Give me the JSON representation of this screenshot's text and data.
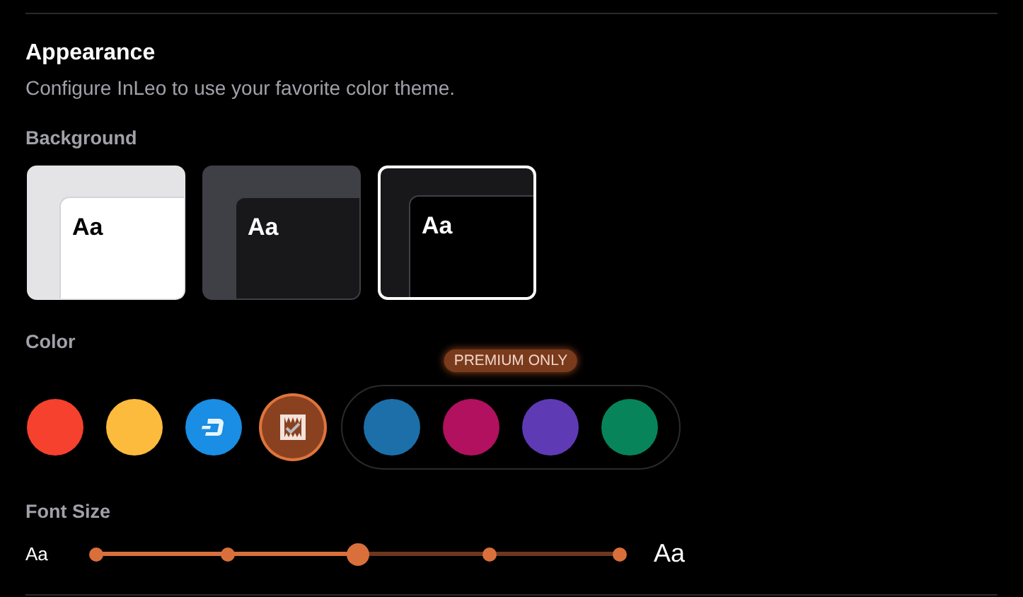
{
  "section": {
    "title": "Appearance",
    "description": "Configure InLeo to use your favorite color theme."
  },
  "background": {
    "label": "Background",
    "options": [
      {
        "kind": "light",
        "sample": "Aa",
        "selected": false
      },
      {
        "kind": "dim",
        "sample": "Aa",
        "selected": false
      },
      {
        "kind": "dark",
        "sample": "Aa",
        "selected": true
      }
    ]
  },
  "color": {
    "label": "Color",
    "swatches": [
      {
        "kind": "plain",
        "color": "#f5412d",
        "selected": false
      },
      {
        "kind": "plain",
        "color": "#fdbb3d",
        "selected": false
      },
      {
        "kind": "dash",
        "color": "#1a8de4",
        "selected": false
      },
      {
        "kind": "leo",
        "color": "#8a4120",
        "selected": true
      }
    ],
    "premium": {
      "badge": "PREMIUM ONLY",
      "swatches": [
        {
          "color": "#1c6fa8",
          "selected": false
        },
        {
          "color": "#b1115f",
          "selected": false
        },
        {
          "color": "#5e3bb5",
          "selected": false
        },
        {
          "color": "#07845a",
          "selected": false
        }
      ]
    }
  },
  "font_size": {
    "label": "Font Size",
    "small_sample": "Aa",
    "large_sample": "Aa",
    "level": 0.5
  }
}
